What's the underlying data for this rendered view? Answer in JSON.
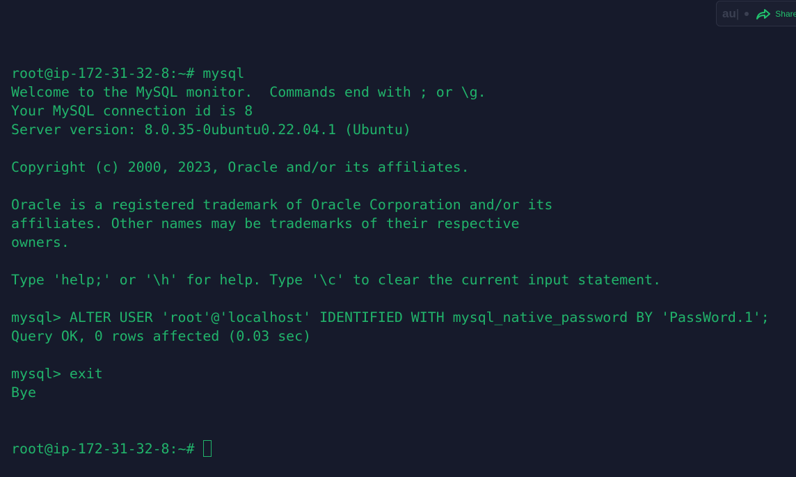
{
  "terminal": {
    "lines": [
      "root@ip-172-31-32-8:~# mysql",
      "Welcome to the MySQL monitor.  Commands end with ; or \\g.",
      "Your MySQL connection id is 8",
      "Server version: 8.0.35-0ubuntu0.22.04.1 (Ubuntu)",
      "",
      "Copyright (c) 2000, 2023, Oracle and/or its affiliates.",
      "",
      "Oracle is a registered trademark of Oracle Corporation and/or its",
      "affiliates. Other names may be trademarks of their respective",
      "owners.",
      "",
      "Type 'help;' or '\\h' for help. Type '\\c' to clear the current input statement.",
      "",
      "mysql> ALTER USER 'root'@'localhost' IDENTIFIED WITH mysql_native_password BY 'PassWord.1';",
      "Query OK, 0 rows affected (0.03 sec)",
      "",
      "mysql> exit",
      "Bye"
    ],
    "prompt": "root@ip-172-31-32-8:~# "
  },
  "widget": {
    "logo": "au",
    "separator": "|",
    "share_label": "Share"
  },
  "colors": {
    "background": "#161a2b",
    "text": "#21b46b"
  }
}
